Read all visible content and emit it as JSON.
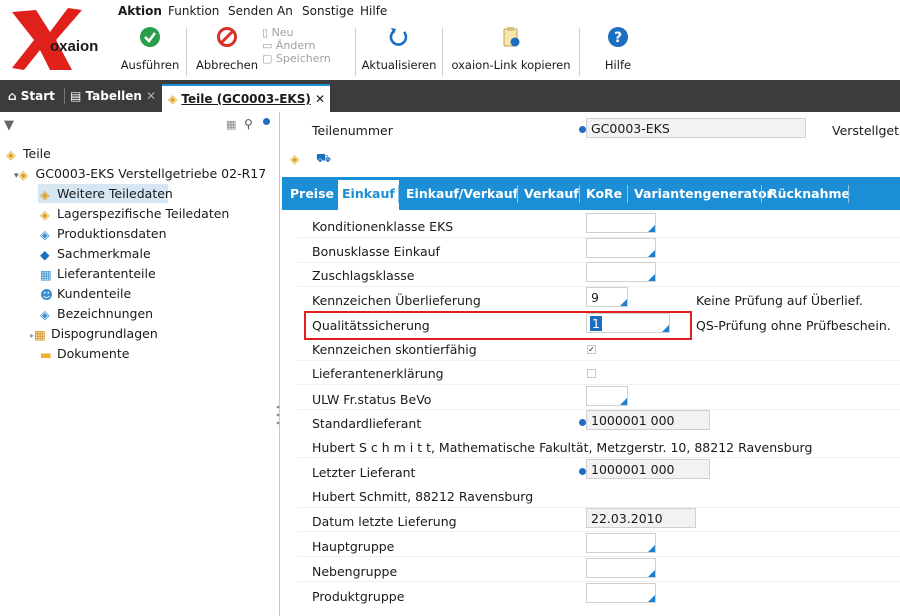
{
  "menu": {
    "items": [
      "Aktion",
      "Funktion",
      "Senden An",
      "Sonstige",
      "Hilfe"
    ]
  },
  "brand": {
    "logo_text": "oxaion"
  },
  "toolbar": {
    "execute": "Ausführen",
    "cancel": "Abbrechen",
    "new": "Neu",
    "change": "Ändern",
    "save": "Speichern",
    "refresh": "Aktualisieren",
    "copy_link": "oxaion-Link kopieren",
    "help": "Hilfe"
  },
  "tabs": {
    "start": "Start",
    "tables": "Tabellen",
    "active": "Teile (GC0003-EKS)"
  },
  "tree": {
    "root": "Teile",
    "part": "GC0003-EKS  Verstellgetriebe 02-R17",
    "children": [
      "Weitere Teiledaten",
      "Lagerspezifische Teiledaten",
      "Produktionsdaten",
      "Sachmerkmale",
      "Lieferantenteile",
      "Kundenteile",
      "Bezeichnungen",
      "Dispogrundlagen",
      "Dokumente"
    ]
  },
  "header": {
    "part_number_label": "Teilenummer",
    "part_number": "GC0003-EKS",
    "truncated_label": "Verstellgetr"
  },
  "subtabs": [
    "Preise",
    "Einkauf",
    "Einkauf/Verkauf",
    "Verkauf",
    "KoRe",
    "Variantengenerator",
    "Rücknahme"
  ],
  "form": {
    "konditionsklasse_label": "Konditionenklasse EKS",
    "bonusklasse_label": "Bonusklasse Einkauf",
    "zuschlagsklasse_label": "Zuschlagsklasse",
    "ueberlieferung_label": "Kennzeichen Überlieferung",
    "ueberlieferung_value": "9",
    "ueberlieferung_desc": "Keine Prüfung auf Überlief.",
    "qualitaet_label": "Qualitätssicherung",
    "qualitaet_value": "1",
    "qualitaet_desc": "QS-Prüfung ohne Prüfbeschein.",
    "skonto_label": "Kennzeichen skontierfähig",
    "lieferantenerklaerung_label": "Lieferantenerklärung",
    "ulw_label": "ULW Fr.status BeVo",
    "standardlieferant_label": "Standardlieferant",
    "standardlieferant_value": "1000001 000",
    "standardlieferant_address": "Hubert S c h m i t t, Mathematische Fakultät, Metzgerstr. 10, 88212 Ravensburg",
    "letzter_lieferant_label": "Letzter Lieferant",
    "letzter_lieferant_value": "1000001 000",
    "letzter_lieferant_address": "Hubert Schmitt, 88212 Ravensburg",
    "datum_label": "Datum letzte Lieferung",
    "datum_value": "22.03.2010",
    "hauptgruppe_label": "Hauptgruppe",
    "nebengruppe_label": "Nebengruppe",
    "produktgruppe_label": "Produktgruppe"
  },
  "colors": {
    "accent": "#1c8ed6",
    "tabstrip": "#3c3c3c",
    "highlight": "#e02020"
  }
}
